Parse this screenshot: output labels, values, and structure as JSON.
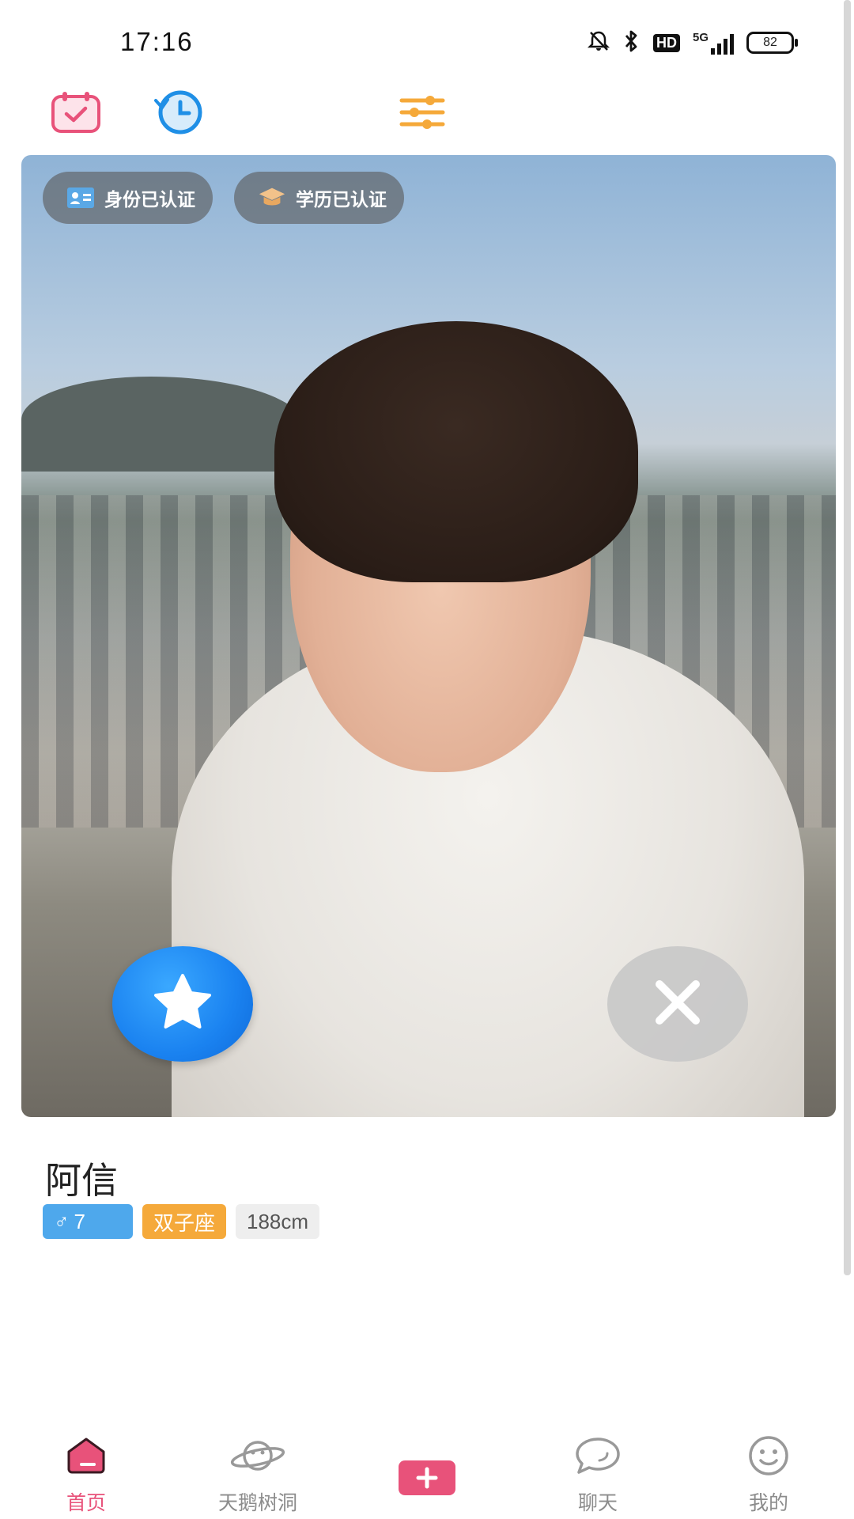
{
  "status_bar": {
    "time": "17:16",
    "network": "5G",
    "hd": "HD",
    "battery": "82"
  },
  "toolbar": {
    "calendar_icon": "calendar-check-icon",
    "history_icon": "history-clock-icon",
    "filter_icon": "filter-sliders-icon"
  },
  "card": {
    "badges": [
      {
        "label": "身份已认证",
        "icon": "id-card-icon"
      },
      {
        "label": "学历已认证",
        "icon": "graduation-cap-icon"
      }
    ],
    "actions": {
      "favorite_icon": "star-icon",
      "dismiss_icon": "close-icon"
    }
  },
  "profile": {
    "name": "阿信",
    "gender_symbol": "♂",
    "age": "7",
    "zodiac": "双子座",
    "height": "188cm"
  },
  "nav": {
    "items": [
      {
        "label": "首页",
        "icon": "home-icon",
        "active": true
      },
      {
        "label": "天鹅树洞",
        "icon": "planet-icon",
        "active": false
      },
      {
        "label": "",
        "icon": "plus-icon",
        "active": false
      },
      {
        "label": "聊天",
        "icon": "chat-bubble-icon",
        "active": false
      },
      {
        "label": "我的",
        "icon": "smiley-icon",
        "active": false
      }
    ]
  },
  "colors": {
    "accent": "#e8527a",
    "filter": "#f5a93a",
    "history": "#1f8fe6",
    "favorite": "#1a82f0"
  }
}
